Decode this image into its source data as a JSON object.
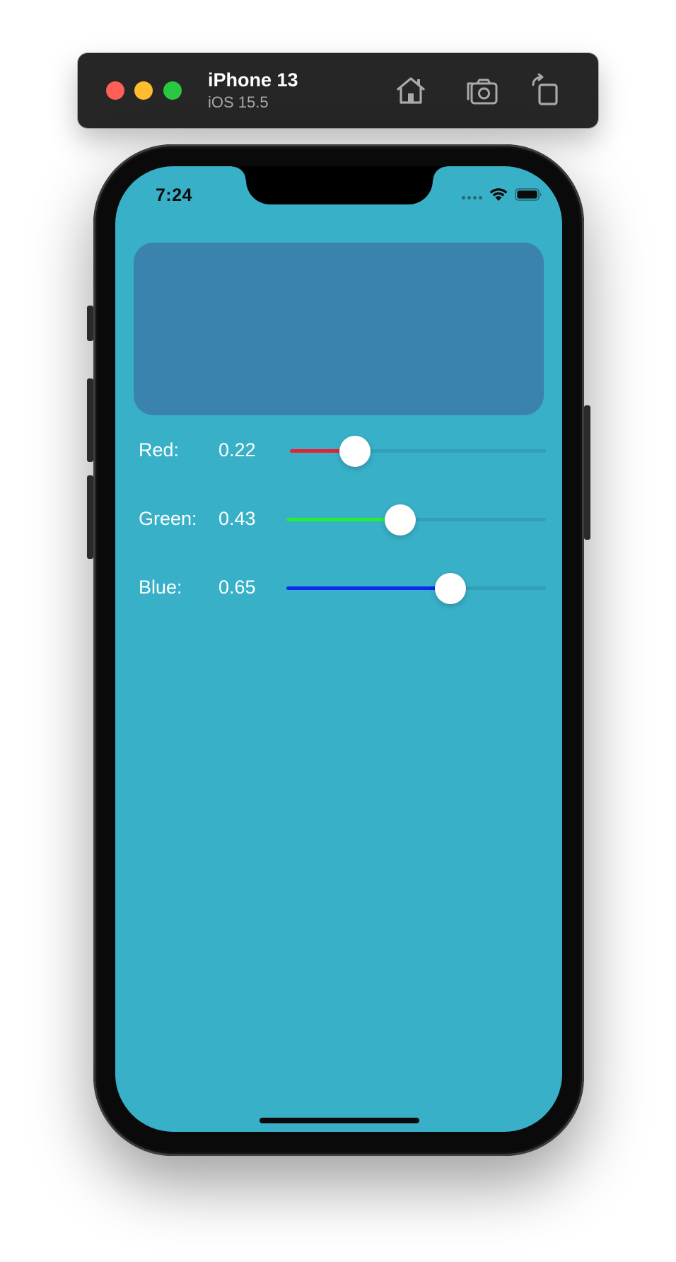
{
  "simulator": {
    "device_name": "iPhone 13",
    "os_version": "iOS 15.5",
    "toolbar_icons": [
      "home-icon",
      "screenshot-icon",
      "rotate-icon"
    ]
  },
  "status_bar": {
    "time": "7:24",
    "icons": [
      "cellular-signal-icon",
      "wifi-icon",
      "battery-icon"
    ]
  },
  "preview": {
    "color": "#3a83ae"
  },
  "sliders": [
    {
      "label": "Red:",
      "value_text": "0.22",
      "fraction": 0.22,
      "fill_color": "#e52233"
    },
    {
      "label": "Green:",
      "value_text": "0.43",
      "fraction": 0.43,
      "fill_color": "#24ee3a"
    },
    {
      "label": "Blue:",
      "value_text": "0.65",
      "fraction": 0.65,
      "fill_color": "#0b2bef"
    }
  ],
  "colors": {
    "screen_background": "#38b0c8",
    "toolbar_background": "#262626"
  }
}
